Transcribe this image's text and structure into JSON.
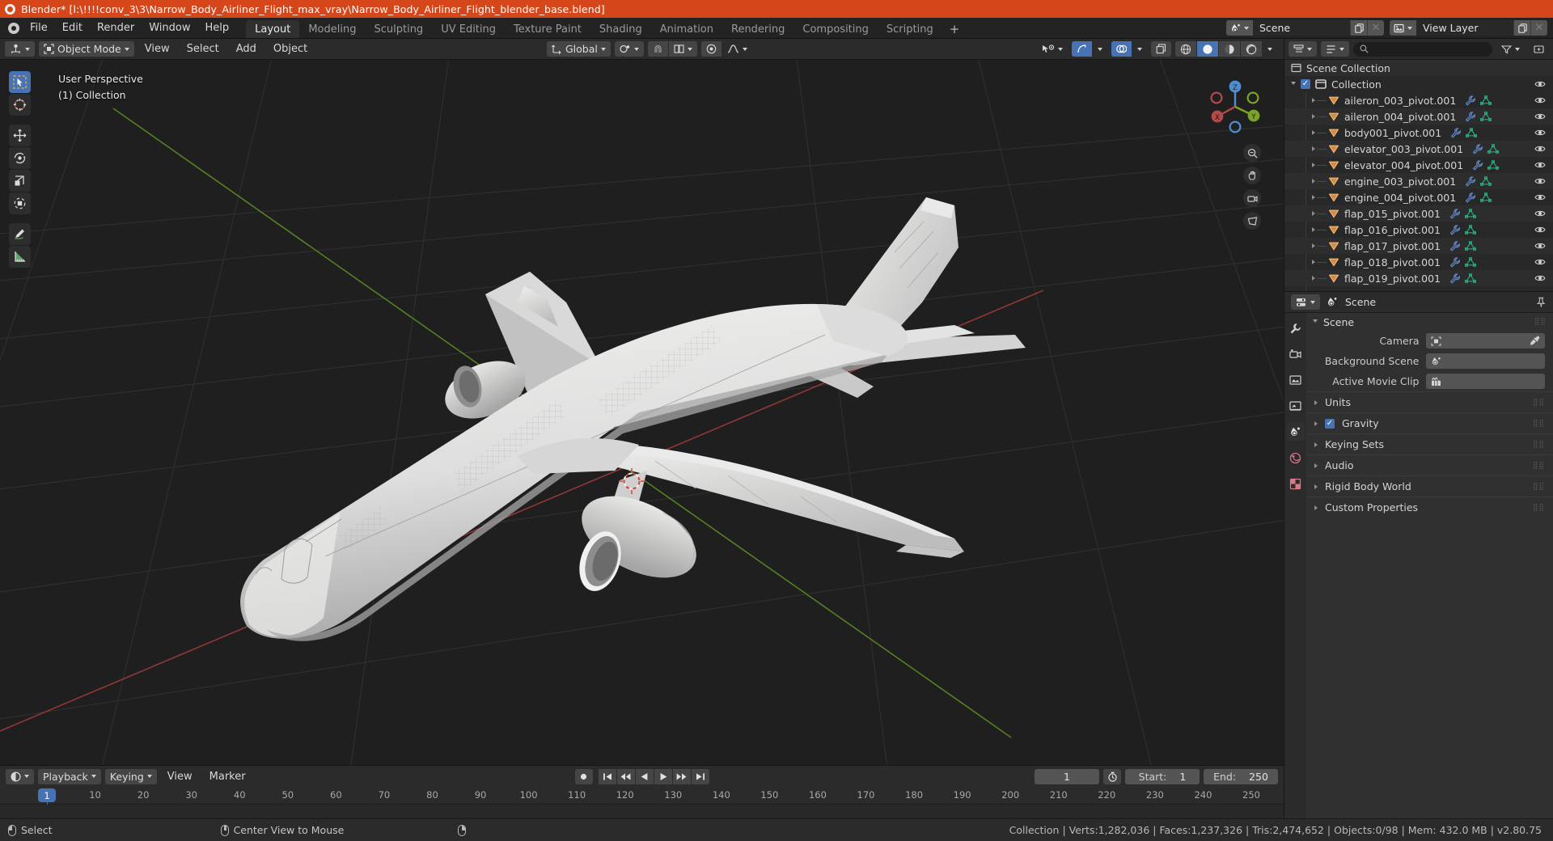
{
  "titlebar": {
    "text": "Blender* [l:\\!!!!conv_3\\3\\Narrow_Body_Airliner_Flight_max_vray\\Narrow_Body_Airliner_Flight_blender_base.blend]"
  },
  "menubar": {
    "items": [
      "File",
      "Edit",
      "Render",
      "Window",
      "Help"
    ],
    "workspaces": [
      "Layout",
      "Modeling",
      "Sculpting",
      "UV Editing",
      "Texture Paint",
      "Shading",
      "Animation",
      "Rendering",
      "Compositing",
      "Scripting"
    ],
    "add_workspace": "+",
    "active_workspace": "Layout",
    "scene_name": "Scene",
    "view_layer_name": "View Layer"
  },
  "viewport": {
    "mode": "Object Mode",
    "menus": [
      "View",
      "Select",
      "Add",
      "Object"
    ],
    "transform_orientation": "Global",
    "overlay_line1": "User Perspective",
    "overlay_line2": "(1) Collection",
    "gizmo_axes": {
      "x": "X",
      "y": "Y",
      "z": "Z"
    },
    "tools": [
      "select-box-tool",
      "cursor-tool",
      "move-tool",
      "rotate-tool",
      "scale-tool",
      "transform-tool",
      "annotate-tool",
      "measure-tool"
    ]
  },
  "outliner": {
    "root": "Scene Collection",
    "collection": "Collection",
    "items": [
      {
        "label": "aileron_003_pivot.001"
      },
      {
        "label": "aileron_004_pivot.001"
      },
      {
        "label": "body001_pivot.001"
      },
      {
        "label": "elevator_003_pivot.001"
      },
      {
        "label": "elevator_004_pivot.001"
      },
      {
        "label": "engine_003_pivot.001"
      },
      {
        "label": "engine_004_pivot.001"
      },
      {
        "label": "flap_015_pivot.001"
      },
      {
        "label": "flap_016_pivot.001"
      },
      {
        "label": "flap_017_pivot.001"
      },
      {
        "label": "flap_018_pivot.001"
      },
      {
        "label": "flap_019_pivot.001"
      }
    ]
  },
  "properties": {
    "breadcrumb": "Scene",
    "panel_title": "Scene",
    "fields": [
      {
        "label": "Camera",
        "value": ""
      },
      {
        "label": "Background Scene",
        "value": ""
      },
      {
        "label": "Active Movie Clip",
        "value": ""
      }
    ],
    "sections": [
      {
        "label": "Units",
        "checkbox": false
      },
      {
        "label": "Gravity",
        "checkbox": true
      },
      {
        "label": "Keying Sets",
        "checkbox": false
      },
      {
        "label": "Audio",
        "checkbox": false
      },
      {
        "label": "Rigid Body World",
        "checkbox": false
      },
      {
        "label": "Custom Properties",
        "checkbox": false
      }
    ]
  },
  "timeline": {
    "menus": [
      "Playback",
      "Keying",
      "View",
      "Marker"
    ],
    "current_frame": "1",
    "start_label": "Start:",
    "start_value": "1",
    "end_label": "End:",
    "end_value": "250",
    "ticks": [
      "10",
      "20",
      "30",
      "40",
      "50",
      "60",
      "70",
      "80",
      "90",
      "100",
      "110",
      "120",
      "130",
      "140",
      "150",
      "160",
      "170",
      "180",
      "190",
      "200",
      "210",
      "220",
      "230",
      "240",
      "250"
    ],
    "playhead_label": "1"
  },
  "statusbar": {
    "left_action": "Select",
    "middle_action": "Center View to Mouse",
    "stats": "Collection | Verts:1,282,036 | Faces:1,237,326 | Tris:2,474,652 | Objects:0/98 | Mem: 432.0 MB | v2.80.75"
  },
  "colors": {
    "accent_orange": "#d6461b",
    "accent_blue": "#4772b3",
    "axis_x": "#b24a4a",
    "axis_y": "#7aa32a"
  }
}
